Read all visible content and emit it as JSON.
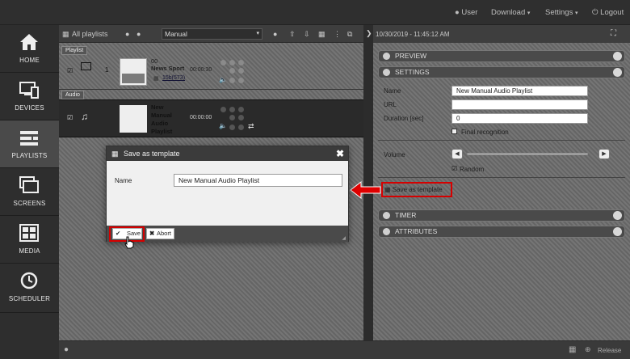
{
  "topbar": {
    "user": "User",
    "download": "Download",
    "settings": "Settings",
    "logout": "Logout"
  },
  "sidebar": {
    "items": [
      {
        "label": "HOME",
        "icon": "home-icon"
      },
      {
        "label": "DEVICES",
        "icon": "devices-icon"
      },
      {
        "label": "PLAYLISTS",
        "icon": "playlists-icon",
        "active": true
      },
      {
        "label": "SCREENS",
        "icon": "screens-icon"
      },
      {
        "label": "MEDIA",
        "icon": "media-icon"
      },
      {
        "label": "SCHEDULER",
        "icon": "scheduler-icon"
      }
    ]
  },
  "left_toolbar": {
    "all_playlists": "All playlists",
    "mode_value": "Manual"
  },
  "playlist_tag": "Playlist",
  "audio_tag": "Audio",
  "playlist_item": {
    "index": "1",
    "code": "00",
    "title": "News Sport",
    "duration": "00:00:30",
    "screen_id": "15b(573)"
  },
  "audio_item": {
    "title_lines": [
      "New",
      "Manual",
      "Audio",
      "Playlist"
    ],
    "duration": "00:00:00"
  },
  "right_toolbar": {
    "datetime": "10/30/2019 - 11:45:12 AM"
  },
  "sections": {
    "preview": "PREVIEW",
    "settings": "SETTINGS",
    "timer": "TIMER",
    "attributes": "ATTRIBUTES"
  },
  "settings_form": {
    "name_label": "Name",
    "name_value": "New Manual Audio Playlist",
    "url_label": "URL",
    "url_value": "",
    "duration_label": "Duration [sec]",
    "duration_value": "0",
    "final_recognition_label": "Final recognition",
    "volume_label": "Volume",
    "random_label": "Random",
    "save_as_template_label": "Save as template"
  },
  "dialog": {
    "title": "Save as template",
    "name_label": "Name",
    "name_value": "New Manual Audio Playlist",
    "save_label": "Save",
    "abort_label": "Abort"
  },
  "bottombar": {
    "release_label": "Release"
  },
  "colors": {
    "highlight_red": "#d60000",
    "topbar": "#2f2f2f",
    "sidebar_active": "#4a4a4a"
  }
}
